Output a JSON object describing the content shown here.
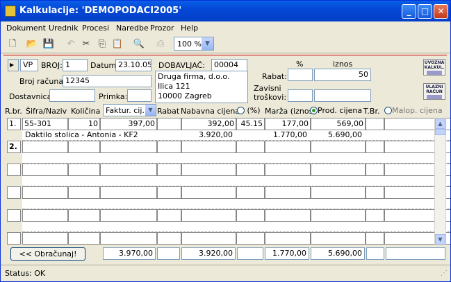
{
  "window": {
    "title": "Kalkulacije: 'DEMOPODACI2005'"
  },
  "menu": [
    "Dokument",
    "Urednik",
    "Procesi",
    "Naredbe",
    "Prozor",
    "Help"
  ],
  "toolbar": {
    "zoom": "100 %"
  },
  "header": {
    "doc_type": "VP",
    "broj_label": "BROJ:",
    "broj": "1",
    "datum_label": "Datum:",
    "datum": "23.10.05",
    "broj_racuna_label": "Broj računa:",
    "broj_racuna": "12345",
    "dostavnica_label": "Dostavnica:",
    "dostavnica": "",
    "primka_label": "Primka:",
    "primka": "",
    "dobavljac_label": "DOBAVLJAČ:",
    "dobavljac_code": "00004",
    "dobavljac_address": [
      "Druga firma, d.o.o.",
      "Ilica 121",
      "10000 Zagreb"
    ],
    "percent_label": "%",
    "iznos_label": "iznos",
    "rabat_label": "Rabat:",
    "rabat_pct": "",
    "rabat_iznos": "50",
    "zavisni_label": "Zavisni troškovi:",
    "zavisni_pct": "",
    "zavisni_iznos": ""
  },
  "side_buttons": [
    {
      "line1": "UVOZNA",
      "line2": "KALKUL."
    },
    {
      "line1": "ULAZNI",
      "line2": "RAČUN"
    }
  ],
  "grid_header": {
    "rbr": "R.br.",
    "sifra": "Šifra/Naziv",
    "kolicina": "Količina",
    "faktur": "Faktur. cij.",
    "rabat": "Rabat",
    "nabavna": "Nabavna cijena",
    "marza_pct": "(%)",
    "marza_iznos": "Marža (iznos)",
    "prod": "Prod. cijena",
    "tbr": "T.Br.",
    "malop": "Malop. cijena"
  },
  "rows": [
    {
      "rbr": "1.",
      "sifra": "55-301",
      "kolicina": "10",
      "faktur": "397,00",
      "rabat": "",
      "nabavna": "392,00",
      "marza_pct": "45.15",
      "marza_iznos": "177,00",
      "prod": "569,00",
      "naziv": "Daktilo stolica - Antonia - KF2",
      "sum_nabavna": "3.920,00",
      "sum_marza": "1.770,00",
      "sum_prod": "5.690,00"
    },
    {
      "rbr": "2."
    }
  ],
  "footer": {
    "obracunaj": "<< Obračunaj!",
    "total_faktur": "3.970,00",
    "total_nabavna": "3.920,00",
    "total_marza": "1.770,00",
    "total_prod": "5.690,00"
  },
  "status": "Status: OK"
}
